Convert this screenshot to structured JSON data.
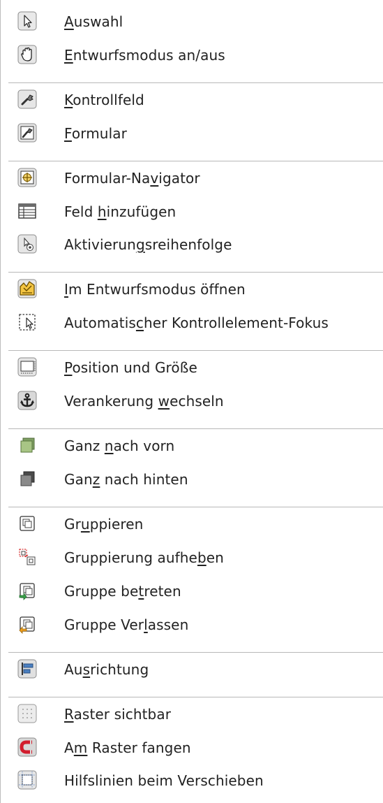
{
  "menu": {
    "items": [
      {
        "icon": "selection-arrow-icon",
        "pre": "",
        "key": "A",
        "post": "uswahl"
      },
      {
        "icon": "design-mode-hand-icon",
        "pre": "",
        "key": "E",
        "post": "ntwurfsmodus an/aus"
      },
      {
        "icon": "control-properties-icon",
        "pre": "",
        "key": "K",
        "post": "ontrollfeld"
      },
      {
        "icon": "form-properties-icon",
        "pre": "",
        "key": "F",
        "post": "ormular"
      },
      {
        "icon": "form-navigator-icon",
        "pre": "Formular-Na",
        "key": "v",
        "post": "igator"
      },
      {
        "icon": "add-field-icon",
        "pre": "Feld ",
        "key": "h",
        "post": "inzufügen"
      },
      {
        "icon": "tab-order-icon",
        "pre": "Aktivierun",
        "key": "g",
        "post": "sreihenfolge"
      },
      {
        "icon": "open-in-design-mode-icon",
        "pre": "",
        "key": "I",
        "post": "m Entwurfsmodus öffnen"
      },
      {
        "icon": "auto-control-focus-icon",
        "pre": "Automatis",
        "key": "c",
        "post": "her Kontrollelement-Fokus"
      },
      {
        "icon": "position-size-icon",
        "pre": "",
        "key": "P",
        "post": "osition und Größe"
      },
      {
        "icon": "anchor-icon",
        "pre": "Verankerung ",
        "key": "w",
        "post": "echseln"
      },
      {
        "icon": "bring-to-front-icon",
        "pre": "Ganz ",
        "key": "n",
        "post": "ach vorn"
      },
      {
        "icon": "send-to-back-icon",
        "pre": "Gan",
        "key": "z",
        "post": " nach hinten"
      },
      {
        "icon": "group-icon",
        "pre": "Gr",
        "key": "u",
        "post": "ppieren"
      },
      {
        "icon": "ungroup-icon",
        "pre": "Gruppierung aufhe",
        "key": "b",
        "post": "en"
      },
      {
        "icon": "enter-group-icon",
        "pre": "Gruppe be",
        "key": "t",
        "post": "reten"
      },
      {
        "icon": "exit-group-icon",
        "pre": "Gruppe Ver",
        "key": "l",
        "post": "assen"
      },
      {
        "icon": "alignment-icon",
        "pre": "Au",
        "key": "s",
        "post": "richtung"
      },
      {
        "icon": "grid-visible-icon",
        "pre": "",
        "key": "R",
        "post": "aster sichtbar"
      },
      {
        "icon": "snap-to-grid-magnet-icon",
        "pre": "A",
        "key": "m",
        "post": " Raster fangen"
      },
      {
        "icon": "helplines-while-moving-icon",
        "pre": "Hilfslinien beim Verschieben",
        "key": "",
        "post": ""
      }
    ]
  }
}
